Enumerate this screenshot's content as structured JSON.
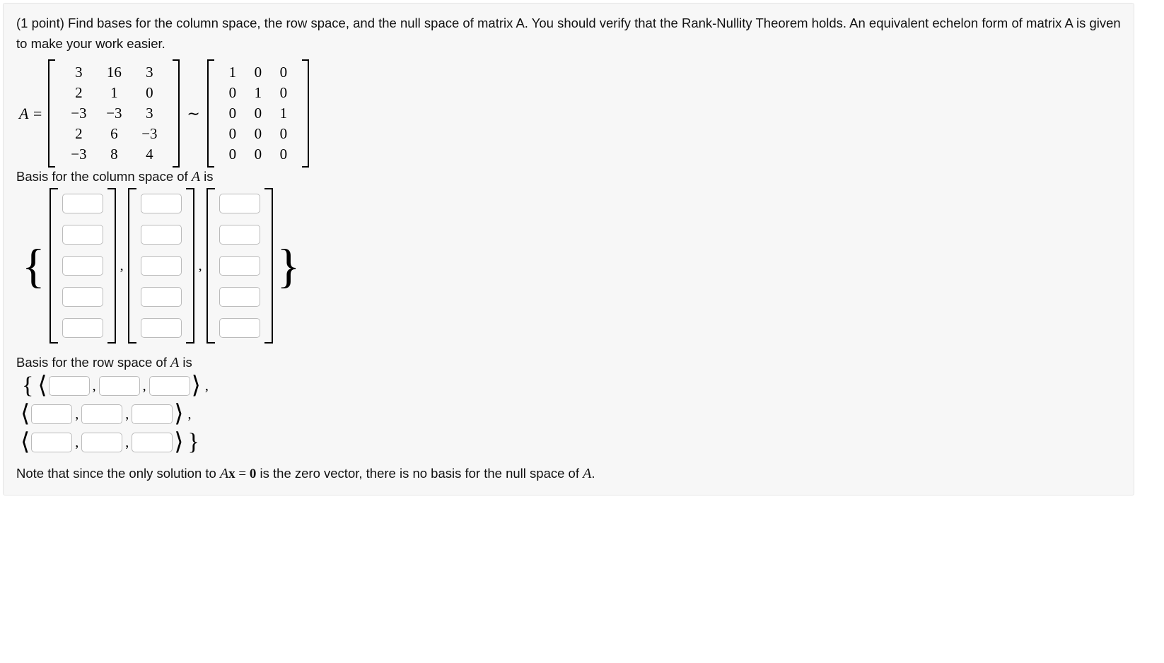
{
  "problem": {
    "points_label": "(1 point)",
    "instructions": "Find bases for the column space, the row space, and the null space of matrix A. You should verify that the Rank-Nullity Theorem holds. An equivalent echelon form of matrix A is given to make your work easier."
  },
  "matrix_eq": {
    "lhs": "A =",
    "A": [
      [
        "3",
        "16",
        "3"
      ],
      [
        "2",
        "1",
        "0"
      ],
      [
        "−3",
        "−3",
        "3"
      ],
      [
        "2",
        "6",
        "−3"
      ],
      [
        "−3",
        "8",
        "4"
      ]
    ],
    "tilde": "∼",
    "E": [
      [
        "1",
        "0",
        "0"
      ],
      [
        "0",
        "1",
        "0"
      ],
      [
        "0",
        "0",
        "1"
      ],
      [
        "0",
        "0",
        "0"
      ],
      [
        "0",
        "0",
        "0"
      ]
    ]
  },
  "labels": {
    "col_basis": "Basis for the column space of ",
    "col_basis_tail": " is",
    "row_basis": "Basis for the row space of ",
    "row_basis_tail": " is",
    "A": "A"
  },
  "note": {
    "pre": "Note that since the only solution to ",
    "eq_lhs": "A",
    "eq_x": "x",
    "eq_eq": " = ",
    "eq_rhs": "0",
    "post": " is the zero vector, there is no basis for the null space of ",
    "A": "A",
    "period": "."
  },
  "glyphs": {
    "lbrace": "{",
    "rbrace": "}",
    "langle": "⟨",
    "rangle": "⟩",
    "comma": ","
  }
}
